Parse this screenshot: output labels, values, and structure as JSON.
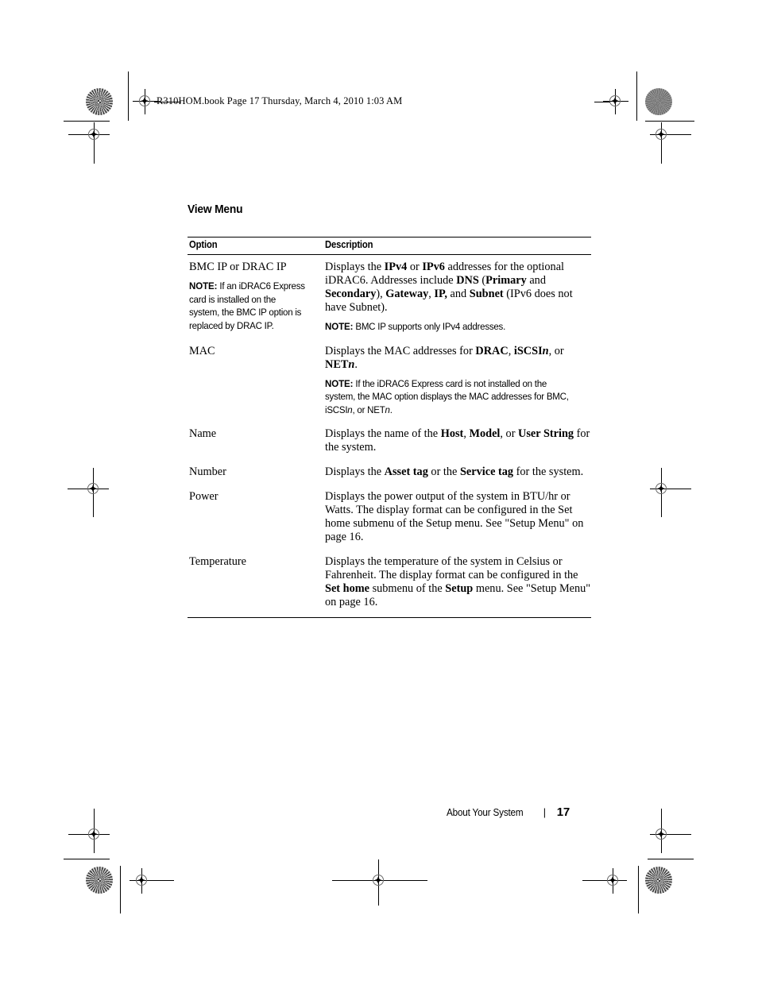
{
  "running_head": "R310HOM.book  Page 17  Thursday, March 4, 2010  1:03 AM",
  "section": {
    "title": "View Menu"
  },
  "table": {
    "headers": {
      "option": "Option",
      "description": "Description"
    },
    "rows": [
      {
        "option": "BMC IP or DRAC IP",
        "option_note_label": "NOTE:",
        "option_note_text": "If an iDRAC6 Express card is installed on the system, the BMC IP option is replaced by DRAC IP.",
        "desc_line1_a": "Displays the ",
        "desc_b1": "IPv4",
        "desc_line1_b": " or ",
        "desc_b2": "IPv6",
        "desc_line1_c": " addresses for the optional iDRAC6. Addresses include ",
        "desc_b3": "DNS",
        "desc_line1_d": " (",
        "desc_b4": "Primary",
        "desc_line1_e": " and ",
        "desc_b5": "Secondary",
        "desc_line1_f": "), ",
        "desc_b6": "Gateway",
        "desc_line1_g": ", ",
        "desc_b7": "IP,",
        "desc_line1_h": " and ",
        "desc_b8": "Subnet",
        "desc_line1_i": " (IPv6 does not have Subnet).",
        "desc_note_label": "NOTE:",
        "desc_note_text": "BMC IP supports only IPv4 addresses."
      },
      {
        "option": "MAC",
        "desc_a": "Displays the MAC addresses for ",
        "desc_b1": "DRAC",
        "desc_b": ", ",
        "desc_b2": "iSCSI",
        "desc_b2i": "n",
        "desc_c": ", or ",
        "desc_b3": "NET",
        "desc_b3i": "n",
        "desc_d": ".",
        "desc_note_label": "NOTE:",
        "desc_note_1": "If the iDRAC6 Express card is not installed on the system, the MAC option displays the MAC addresses for BMC, iSCSI",
        "desc_note_i1": "n",
        "desc_note_2": ", or NET",
        "desc_note_i2": "n",
        "desc_note_3": "."
      },
      {
        "option": "Name",
        "desc_a": "Displays the name of the ",
        "desc_b1": "Host",
        "desc_b": ", ",
        "desc_b2": "Model",
        "desc_c": ", or ",
        "desc_b3": "User String",
        "desc_d": " for the system."
      },
      {
        "option": "Number",
        "desc_a": "Displays the ",
        "desc_b1": "Asset tag",
        "desc_b": " or the ",
        "desc_b2": "Service tag",
        "desc_c": " for the system."
      },
      {
        "option": "Power",
        "desc_a": "Displays the power output of the system in BTU/hr or Watts. The display format can be configured in the Set home submenu of the Setup menu. See \"Setup Menu\" on page 16."
      },
      {
        "option": "Temperature",
        "desc_a": "Displays the temperature of the system in Celsius or Fahrenheit. The display format can be configured in the ",
        "desc_b1": "Set home",
        "desc_b": " submenu of the ",
        "desc_b2": "Setup",
        "desc_c": " menu. See \"Setup Menu\" on page 16."
      }
    ]
  },
  "footer": {
    "section": "About Your System",
    "separator": "|",
    "page": "17"
  }
}
